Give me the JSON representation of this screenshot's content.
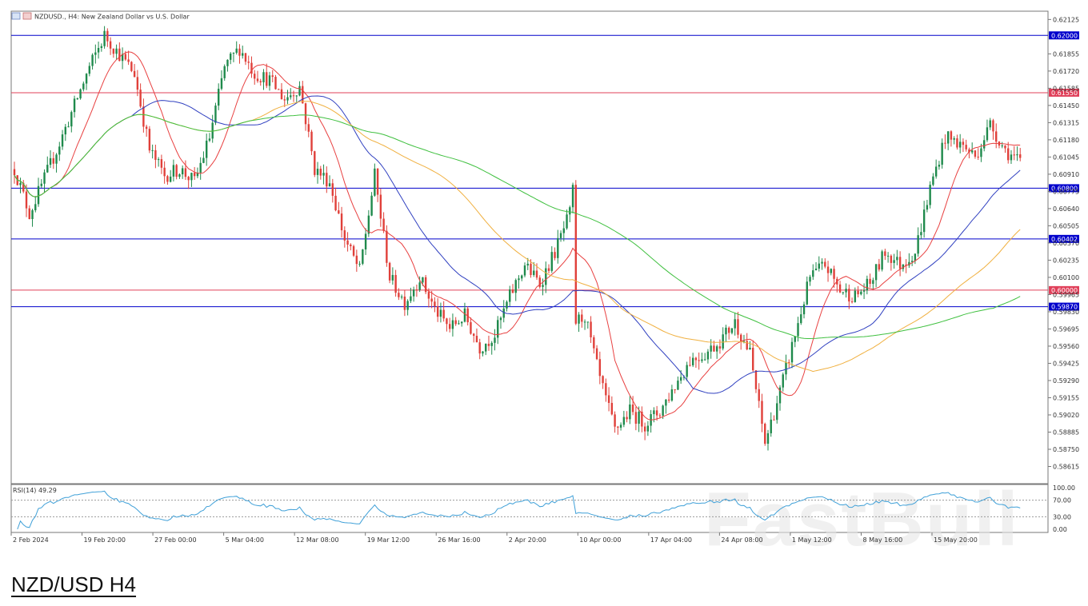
{
  "header": {
    "title": "NZDUSD., H4:  New Zealand Dollar vs U.S. Dollar"
  },
  "caption": "NZD/USD H4",
  "watermark": "FastBull",
  "colors": {
    "bull": "#1f8a4c",
    "bear": "#e0403a",
    "ma_red": "#e84040",
    "ma_blue": "#3040c0",
    "ma_orange": "#f0b040",
    "ma_green": "#40c040",
    "line_blue": "#0000cc",
    "line_red": "#e0405a",
    "rsi": "#3fa0d8"
  },
  "chart_data": [
    {
      "type": "candlestick",
      "symbol": "NZDUSD.",
      "timeframe": "H4",
      "ylim": [
        0.5848,
        0.6219
      ],
      "y_ticks": [
        "0.62125",
        "0.61855",
        "0.61720",
        "0.61585",
        "0.61450",
        "0.61315",
        "0.61180",
        "0.61045",
        "0.60910",
        "0.60775",
        "0.60640",
        "0.60505",
        "0.60370",
        "0.60235",
        "0.60100",
        "0.59965",
        "0.59830",
        "0.59695",
        "0.59560",
        "0.59425",
        "0.59290",
        "0.59155",
        "0.59020",
        "0.58885",
        "0.58750",
        "0.58615"
      ],
      "x_ticks": [
        "2 Feb 2024",
        "19 Feb 20:00",
        "27 Feb 00:00",
        "5 Mar 04:00",
        "12 Mar 08:00",
        "19 Mar 12:00",
        "26 Mar 16:00",
        "2 Apr 20:00",
        "10 Apr 00:00",
        "17 Apr 04:00",
        "24 Apr 08:00",
        "1 May 12:00",
        "8 May 16:00",
        "15 May 20:00"
      ],
      "close_path": [
        [
          0,
          0.6095
        ],
        [
          5,
          0.606
        ],
        [
          15,
          0.6115
        ],
        [
          25,
          0.6175
        ],
        [
          30,
          0.62
        ],
        [
          35,
          0.6185
        ],
        [
          40,
          0.617
        ],
        [
          45,
          0.611
        ],
        [
          50,
          0.609
        ],
        [
          55,
          0.6095
        ],
        [
          60,
          0.6085
        ],
        [
          65,
          0.612
        ],
        [
          70,
          0.6175
        ],
        [
          75,
          0.619
        ],
        [
          80,
          0.617
        ],
        [
          85,
          0.6165
        ],
        [
          90,
          0.615
        ],
        [
          95,
          0.616
        ],
        [
          100,
          0.6095
        ],
        [
          105,
          0.6085
        ],
        [
          110,
          0.604
        ],
        [
          115,
          0.6015
        ],
        [
          120,
          0.609
        ],
        [
          125,
          0.601
        ],
        [
          130,
          0.599
        ],
        [
          135,
          0.601
        ],
        [
          140,
          0.5985
        ],
        [
          145,
          0.597
        ],
        [
          150,
          0.598
        ],
        [
          155,
          0.5955
        ],
        [
          160,
          0.5965
        ],
        [
          165,
          0.5995
        ],
        [
          170,
          0.602
        ],
        [
          175,
          0.6005
        ],
        [
          180,
          0.603
        ],
        [
          185,
          0.606
        ],
        [
          186,
          0.6078
        ],
        [
          187,
          0.5975
        ],
        [
          190,
          0.598
        ],
        [
          195,
          0.593
        ],
        [
          200,
          0.589
        ],
        [
          205,
          0.5905
        ],
        [
          210,
          0.5895
        ],
        [
          215,
          0.5905
        ],
        [
          220,
          0.5925
        ],
        [
          225,
          0.5945
        ],
        [
          230,
          0.595
        ],
        [
          235,
          0.596
        ],
        [
          240,
          0.5975
        ],
        [
          245,
          0.595
        ],
        [
          250,
          0.588
        ],
        [
          255,
          0.592
        ],
        [
          260,
          0.5965
        ],
        [
          265,
          0.601
        ],
        [
          270,
          0.602
        ],
        [
          275,
          0.6
        ],
        [
          280,
          0.5995
        ],
        [
          285,
          0.6005
        ],
        [
          290,
          0.603
        ],
        [
          295,
          0.602
        ],
        [
          300,
          0.603
        ],
        [
          305,
          0.608
        ],
        [
          310,
          0.612
        ],
        [
          315,
          0.6115
        ],
        [
          320,
          0.6105
        ],
        [
          325,
          0.613
        ],
        [
          330,
          0.611
        ],
        [
          335,
          0.61
        ]
      ],
      "close_path_units": "bar index, price",
      "moving_averages": [
        {
          "color": "#e84040"
        },
        {
          "color": "#3040c0"
        },
        {
          "color": "#f0b040"
        },
        {
          "color": "#40c040"
        }
      ],
      "horizontal_levels": [
        {
          "value": 0.62,
          "label": "0.62000",
          "color": "#0000cc"
        },
        {
          "value": 0.6155,
          "label": "0.61550",
          "color": "#e0405a"
        },
        {
          "value": 0.608,
          "label": "0.60800",
          "color": "#0000cc"
        },
        {
          "value": 0.60402,
          "label": "0.60402",
          "color": "#0000cc"
        },
        {
          "value": 0.6,
          "label": "0.60000",
          "color": "#e0405a"
        },
        {
          "value": 0.5987,
          "label": "0.59870",
          "color": "#0000cc"
        }
      ]
    },
    {
      "type": "line",
      "name": "RSI(14)",
      "label": "RSI(14) 49.29",
      "value": 49.29,
      "ylim": [
        0,
        100
      ],
      "y_ticks": [
        "100.00",
        "70.00",
        "30.00",
        "0.00"
      ],
      "levels": [
        70,
        30
      ]
    }
  ]
}
